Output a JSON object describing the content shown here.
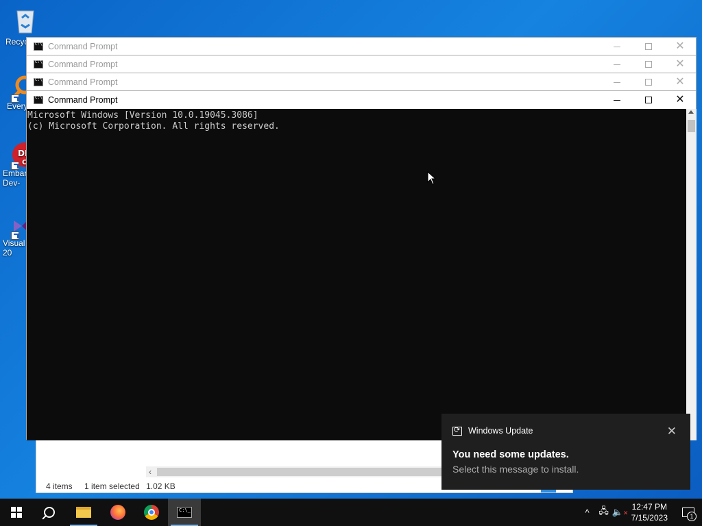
{
  "desktop": {
    "icons": [
      {
        "label": "Recyc",
        "icon": "recycle-bin-icon"
      },
      {
        "label": "Every",
        "icon": "everything-search-icon"
      },
      {
        "label": "Embar\nDev-",
        "icon": "embarcadero-devcpp-icon"
      },
      {
        "label": "Visual\n20",
        "icon": "visual-studio-icon"
      }
    ]
  },
  "explorer": {
    "status_items": "4 items",
    "status_selected": "1 item selected",
    "status_size": "1.02 KB"
  },
  "cmd_windows": [
    {
      "title": "Command Prompt"
    },
    {
      "title": "Command Prompt"
    },
    {
      "title": "Command Prompt"
    },
    {
      "title": "Command Prompt"
    }
  ],
  "console": {
    "lines": "Microsoft Windows [Version 10.0.19045.3086]\n(c) Microsoft Corporation. All rights reserved."
  },
  "toast": {
    "app": "Windows Update",
    "title": "You need some updates.",
    "body": "Select this message to install."
  },
  "taskbar": {
    "time": "12:47 PM",
    "date": "7/15/2023",
    "notification_count": "1",
    "pinned": [
      "start",
      "search",
      "file-explorer",
      "firefox",
      "chrome",
      "command-prompt"
    ]
  },
  "colors": {
    "desktop": "#0a64c8",
    "console_bg": "#0c0c0c",
    "console_fg": "#cccccc",
    "taskbar": "#101010",
    "toast_bg": "#1f1f1f"
  }
}
